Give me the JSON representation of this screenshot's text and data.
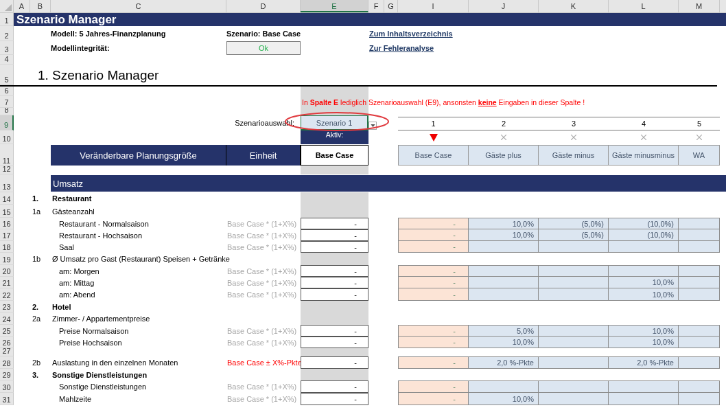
{
  "column_headers": [
    {
      "label": "A",
      "selected": false
    },
    {
      "label": "B",
      "selected": false
    },
    {
      "label": "C",
      "selected": false
    },
    {
      "label": "D",
      "selected": false
    },
    {
      "label": "E",
      "selected": true
    },
    {
      "label": "F",
      "selected": false
    },
    {
      "label": "G",
      "selected": false
    },
    {
      "label": "I",
      "selected": false
    },
    {
      "label": "J",
      "selected": false
    },
    {
      "label": "K",
      "selected": false
    },
    {
      "label": "L",
      "selected": false
    },
    {
      "label": "M",
      "selected": false
    }
  ],
  "row_numbers": [
    {
      "label": "1",
      "selected": false
    },
    {
      "label": "2",
      "selected": false
    },
    {
      "label": "3",
      "selected": false
    },
    {
      "label": "4",
      "selected": false
    },
    {
      "label": "5",
      "selected": false
    },
    {
      "label": "6",
      "selected": false
    },
    {
      "label": "7",
      "selected": false
    },
    {
      "label": "8",
      "selected": false
    },
    {
      "label": "9",
      "selected": true
    },
    {
      "label": "10",
      "selected": false
    },
    {
      "label": "11",
      "selected": false
    },
    {
      "label": "12",
      "selected": false
    },
    {
      "label": "13",
      "selected": false
    },
    {
      "label": "14",
      "selected": false
    },
    {
      "label": "15",
      "selected": false
    },
    {
      "label": "16",
      "selected": false
    },
    {
      "label": "17",
      "selected": false
    },
    {
      "label": "18",
      "selected": false
    },
    {
      "label": "19",
      "selected": false
    },
    {
      "label": "20",
      "selected": false
    },
    {
      "label": "21",
      "selected": false
    },
    {
      "label": "22",
      "selected": false
    },
    {
      "label": "23",
      "selected": false
    },
    {
      "label": "24",
      "selected": false
    },
    {
      "label": "25",
      "selected": false
    },
    {
      "label": "26",
      "selected": false
    },
    {
      "label": "27",
      "selected": false
    },
    {
      "label": "28",
      "selected": false
    },
    {
      "label": "29",
      "selected": false
    },
    {
      "label": "30",
      "selected": false
    },
    {
      "label": "31",
      "selected": false
    }
  ],
  "title": "Szenario Manager",
  "model": "Modell: 5 Jahres-Finanzplanung",
  "scenario": "Szenario: Base Case",
  "integrity_label": "Modellintegrität:",
  "integrity_status": "Ok",
  "links": [
    "Zum Inhaltsverzeichnis",
    "Zur Fehleranalyse"
  ],
  "heading": "1. Szenario Manager",
  "notice": [
    {
      "text": "In ",
      "bold": false,
      "underline": false
    },
    {
      "text": "Spalte E",
      "bold": true,
      "underline": false
    },
    {
      "text": " lediglich Szenarioauswahl (E9), ansonsten ",
      "bold": false,
      "underline": false
    },
    {
      "text": "keine",
      "bold": true,
      "underline": true
    },
    {
      "text": " Eingaben in dieser Spalte !",
      "bold": false,
      "underline": false
    }
  ],
  "selector": {
    "label": "Szenarioauswahl:",
    "value": "Szenario 1"
  },
  "active_label": "Aktiv:",
  "scenarios": [
    {
      "number": "1",
      "name": "Base Case",
      "active": true
    },
    {
      "number": "2",
      "name": "Gäste plus",
      "active": false
    },
    {
      "number": "3",
      "name": "Gäste minus",
      "active": false
    },
    {
      "number": "4",
      "name": "Gäste minusminus",
      "active": false
    },
    {
      "number": "5",
      "name": "WA",
      "active": false
    }
  ],
  "table_header": {
    "item": "Veränderbare Planungsgröße",
    "unit": "Einheit",
    "current": "Base Case"
  },
  "section": "Umsatz",
  "rows": [
    {
      "kind": "group",
      "code": "1.",
      "label": "Restaurant"
    },
    {
      "kind": "sub",
      "code": "1a",
      "label": "Gästeanzahl"
    },
    {
      "kind": "item",
      "label": "Restaurant - Normalsaison",
      "unit": "Base Case * (1+X%)",
      "unit_warning": false,
      "value": "-",
      "base": "-",
      "values": [
        {
          "kind": "value",
          "text": "10,0%"
        },
        {
          "kind": "value",
          "text": "(5,0%)"
        },
        {
          "kind": "value",
          "text": "(10,0%)"
        },
        {
          "kind": "empty"
        }
      ]
    },
    {
      "kind": "item",
      "label": "Restaurant - Hochsaison",
      "unit": "Base Case * (1+X%)",
      "unit_warning": false,
      "value": "-",
      "base": "-",
      "values": [
        {
          "kind": "value",
          "text": "10,0%"
        },
        {
          "kind": "value",
          "text": "(5,0%)"
        },
        {
          "kind": "value",
          "text": "(10,0%)"
        },
        {
          "kind": "empty"
        }
      ]
    },
    {
      "kind": "item",
      "label": "Saal",
      "unit": "Base Case * (1+X%)",
      "unit_warning": false,
      "value": "-",
      "base": "-",
      "values": [
        {
          "kind": "empty"
        },
        {
          "kind": "empty"
        },
        {
          "kind": "empty"
        },
        {
          "kind": "empty"
        }
      ]
    },
    {
      "kind": "sub",
      "code": "1b",
      "label": "Ø Umsatz pro Gast (Restaurant) Speisen + Getränke"
    },
    {
      "kind": "item",
      "label": "am: Morgen",
      "unit": "Base Case * (1+X%)",
      "unit_warning": false,
      "value": "-",
      "base": "-",
      "values": [
        {
          "kind": "empty"
        },
        {
          "kind": "empty"
        },
        {
          "kind": "empty"
        },
        {
          "kind": "empty"
        }
      ]
    },
    {
      "kind": "item",
      "label": "am: Mittag",
      "unit": "Base Case * (1+X%)",
      "unit_warning": false,
      "value": "-",
      "base": "-",
      "values": [
        {
          "kind": "empty"
        },
        {
          "kind": "empty"
        },
        {
          "kind": "value",
          "text": "10,0%"
        },
        {
          "kind": "empty"
        }
      ]
    },
    {
      "kind": "item",
      "label": "am: Abend",
      "unit": "Base Case * (1+X%)",
      "unit_warning": false,
      "value": "-",
      "base": "-",
      "values": [
        {
          "kind": "empty"
        },
        {
          "kind": "empty"
        },
        {
          "kind": "value",
          "text": "10,0%"
        },
        {
          "kind": "empty"
        }
      ]
    },
    {
      "kind": "group",
      "code": "2.",
      "label": "Hotel"
    },
    {
      "kind": "sub",
      "code": "2a",
      "label": "Zimmer- / Appartementpreise"
    },
    {
      "kind": "item",
      "label": "Preise Normalsaison",
      "unit": "Base Case * (1+X%)",
      "unit_warning": false,
      "value": "-",
      "base": "-",
      "values": [
        {
          "kind": "value",
          "text": "5,0%"
        },
        {
          "kind": "empty"
        },
        {
          "kind": "value",
          "text": "10,0%"
        },
        {
          "kind": "empty"
        }
      ]
    },
    {
      "kind": "item",
      "label": "Preise Hochsaison",
      "unit": "Base Case * (1+X%)",
      "unit_warning": false,
      "value": "-",
      "base": "-",
      "values": [
        {
          "kind": "value",
          "text": "10,0%"
        },
        {
          "kind": "empty"
        },
        {
          "kind": "value",
          "text": "10,0%"
        },
        {
          "kind": "empty"
        }
      ]
    },
    {
      "kind": "spacer"
    },
    {
      "kind": "sub",
      "code": "2b",
      "label": "Auslastung in den einzelnen Monaten",
      "unit": "Base Case ± X%-Pkte",
      "unit_warning": true,
      "value": "-",
      "base": "-",
      "values": [
        {
          "kind": "value",
          "text": "2,0 %-Pkte"
        },
        {
          "kind": "empty"
        },
        {
          "kind": "value",
          "text": "2,0 %-Pkte"
        },
        {
          "kind": "empty"
        }
      ]
    },
    {
      "kind": "group",
      "code": "3.",
      "label": "Sonstige Dienstleistungen"
    },
    {
      "kind": "item",
      "label": "Sonstige Dienstleistungen",
      "unit": "Base Case * (1+X%)",
      "unit_warning": false,
      "value": "-",
      "base": "-",
      "values": [
        {
          "kind": "empty"
        },
        {
          "kind": "empty"
        },
        {
          "kind": "empty"
        },
        {
          "kind": "empty"
        }
      ]
    },
    {
      "kind": "item",
      "label": "Mahlzeite",
      "unit": "Base Case * (1+X%)",
      "unit_warning": false,
      "value": "-",
      "base": "-",
      "values": [
        {
          "kind": "value",
          "text": "10,0%"
        },
        {
          "kind": "empty"
        },
        {
          "kind": "empty"
        },
        {
          "kind": "empty"
        }
      ]
    }
  ]
}
